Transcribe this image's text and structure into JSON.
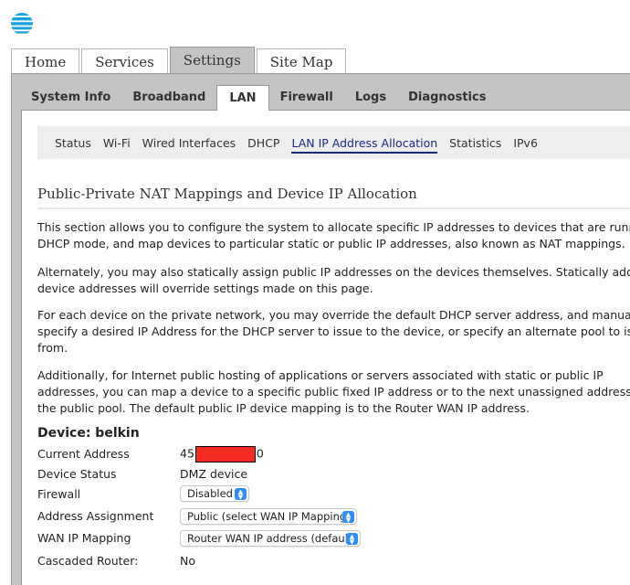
{
  "brand": {
    "logo_icon": "att-globe-icon",
    "accent": "#1aa2dd"
  },
  "top_tabs": [
    {
      "label": "Home",
      "active": false
    },
    {
      "label": "Services",
      "active": false
    },
    {
      "label": "Settings",
      "active": true
    },
    {
      "label": "Site Map",
      "active": false
    }
  ],
  "sub_tabs": [
    {
      "label": "System Info",
      "active": false
    },
    {
      "label": "Broadband",
      "active": false
    },
    {
      "label": "LAN",
      "active": true
    },
    {
      "label": "Firewall",
      "active": false
    },
    {
      "label": "Logs",
      "active": false
    },
    {
      "label": "Diagnostics",
      "active": false
    }
  ],
  "lan_nav": [
    {
      "label": "Status",
      "active": false
    },
    {
      "label": "Wi-Fi",
      "active": false
    },
    {
      "label": "Wired Interfaces",
      "active": false
    },
    {
      "label": "DHCP",
      "active": false
    },
    {
      "label": "LAN IP Address Allocation",
      "active": true
    },
    {
      "label": "Statistics",
      "active": false
    },
    {
      "label": "IPv6",
      "active": false
    }
  ],
  "page": {
    "title": "Public-Private NAT Mappings and Device IP Allocation",
    "paragraphs": [
      [
        "This section allows you to configure the system to allocate specific IP addresses to devices that are running in",
        "DHCP mode, and map devices to particular static or public IP addresses, also known as NAT mappings."
      ],
      [
        "Alternately, you may also statically assign public IP addresses on the devices themselves. Statically addressed",
        "device addresses will override settings made on this page."
      ],
      [
        "For each device on the private network, you may override the default DHCP server address, and manually",
        "specify a desired IP Address for the DHCP server to issue to the device, or specify an alternate pool to issue",
        "from."
      ],
      [
        "Additionally, for Internet public hosting of applications or servers associated with static or public IP",
        "addresses, you can map a device to a specific public fixed IP address or to the next unassigned address from",
        "the public pool. The default public IP device mapping is to the Router WAN IP address."
      ]
    ]
  },
  "device": {
    "heading": "Device: belkin",
    "current_address_label": "Current Address",
    "current_address_prefix": "45",
    "current_address_suffix": "0",
    "device_status_label": "Device Status",
    "device_status_value": "DMZ device",
    "firewall_label": "Firewall",
    "firewall_value": "Disabled",
    "address_assignment_label": "Address Assignment",
    "address_assignment_value": "Public (select WAN IP Mapping)",
    "wan_ip_mapping_label": "WAN IP Mapping",
    "wan_ip_mapping_value": "Router WAN IP address (default)",
    "cascaded_router_label": "Cascaded Router:",
    "cascaded_router_value": "No"
  },
  "colors": {
    "redaction": "#f52a20",
    "active_link": "#1a2a7a",
    "select_arrow": "#2f8df6"
  }
}
